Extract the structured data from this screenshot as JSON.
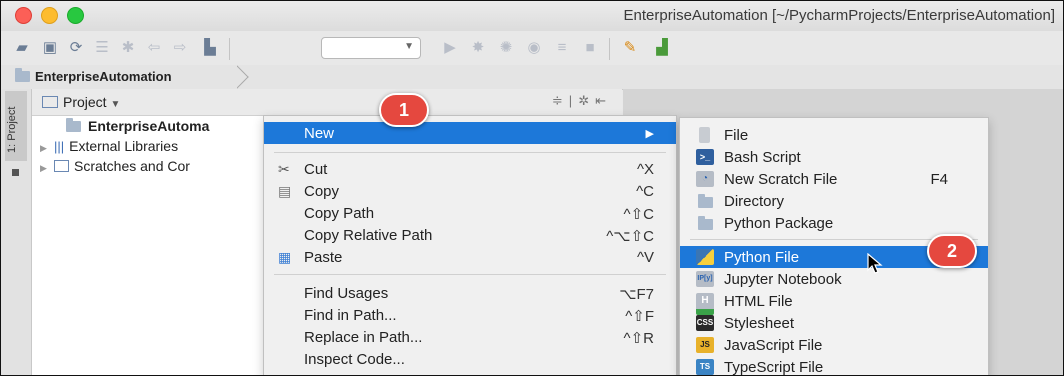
{
  "window": {
    "title": "EnterpriseAutomation [~/PycharmProjects/EnterpriseAutomation]"
  },
  "navbar": {
    "breadcrumb": "EnterpriseAutomation"
  },
  "sidebar_strip": {
    "tab_label": "1: Project"
  },
  "project_panel": {
    "header": "Project",
    "tree": [
      {
        "label": "EnterpriseAutoma"
      },
      {
        "label": "External Libraries"
      },
      {
        "label": "Scratches and Cor"
      }
    ]
  },
  "context_menu": {
    "new": {
      "label": "New"
    },
    "cut": {
      "label": "Cut",
      "shortcut": "^X"
    },
    "copy": {
      "label": "Copy",
      "shortcut": "^C"
    },
    "copy_path": {
      "label": "Copy Path",
      "shortcut": "^⇧C"
    },
    "copy_relative_path": {
      "label": "Copy Relative Path",
      "shortcut": "^⌥⇧C"
    },
    "paste": {
      "label": "Paste",
      "shortcut": "^V"
    },
    "find_usages": {
      "label": "Find Usages",
      "shortcut": "⌥F7"
    },
    "find_in_path": {
      "label": "Find in Path...",
      "shortcut": "^⇧F"
    },
    "replace_in_path": {
      "label": "Replace in Path...",
      "shortcut": "^⇧R"
    },
    "inspect_code": {
      "label": "Inspect Code..."
    }
  },
  "submenu": {
    "file": {
      "label": "File"
    },
    "bash_script": {
      "label": "Bash Script"
    },
    "new_scratch_file": {
      "label": "New Scratch File",
      "shortcut": "F4"
    },
    "directory": {
      "label": "Directory"
    },
    "python_package": {
      "label": "Python Package"
    },
    "python_file": {
      "label": "Python File"
    },
    "jupyter_notebook": {
      "label": "Jupyter Notebook"
    },
    "html_file": {
      "label": "HTML File"
    },
    "stylesheet": {
      "label": "Stylesheet"
    },
    "javascript_file": {
      "label": "JavaScript File"
    },
    "typescript_file": {
      "label": "TypeScript File"
    }
  },
  "annotations": {
    "step1": "1",
    "step2": "2"
  },
  "colors": {
    "highlight": "#1d78d9",
    "badge": "#e5483f"
  }
}
